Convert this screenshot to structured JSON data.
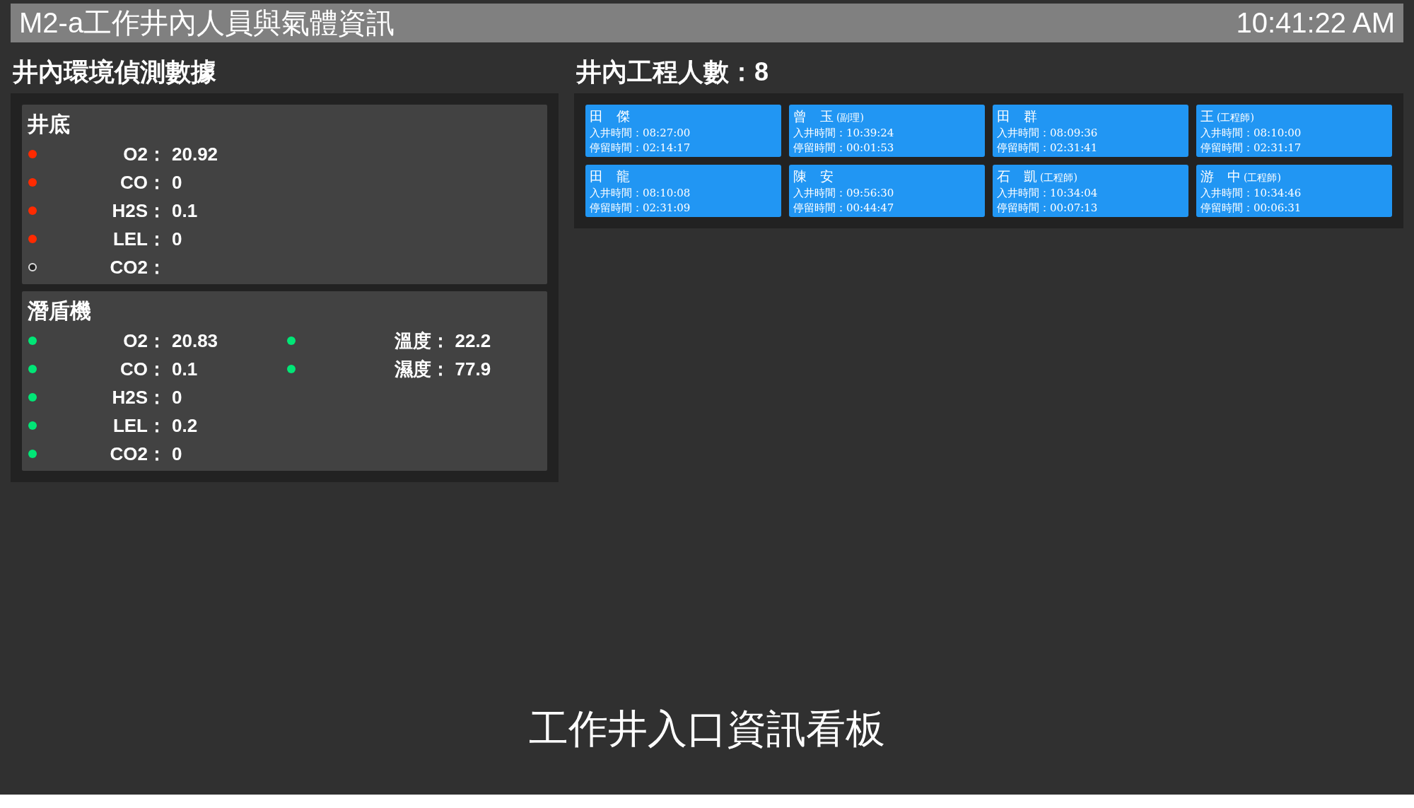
{
  "header": {
    "title": "M2-a工作井內人員與氣體資訊",
    "clock": "10:41:22 AM"
  },
  "environment": {
    "title": "井內環境偵測數據",
    "sections": [
      {
        "title": "井底",
        "gases": [
          {
            "label": "O2：",
            "value": "20.92",
            "color": "#ff2a00",
            "online": true
          },
          {
            "label": "CO：",
            "value": "0",
            "color": "#ff2a00",
            "online": true
          },
          {
            "label": "H2S：",
            "value": "0.1",
            "color": "#ff2a00",
            "online": true
          },
          {
            "label": "LEL：",
            "value": "0",
            "color": "#ff2a00",
            "online": true
          },
          {
            "label": "CO2：",
            "color": "#222222",
            "online": false
          }
        ]
      },
      {
        "title": "潛盾機",
        "gases": [
          {
            "label": "O2：",
            "value": "20.83",
            "color": "#00e676",
            "online": true
          },
          {
            "label": "CO：",
            "value": "0.1",
            "color": "#00e676",
            "online": true
          },
          {
            "label": "H2S：",
            "value": "0",
            "color": "#00e676",
            "online": true
          },
          {
            "label": "LEL：",
            "value": "0.2",
            "color": "#00e676",
            "online": true
          },
          {
            "label": "CO2：",
            "value": "0",
            "color": "#00e676",
            "online": true
          }
        ],
        "extras": [
          {
            "label": "溫度：",
            "value": "22.2",
            "color": "#00e676",
            "online": true
          },
          {
            "label": "濕度：",
            "value": "77.9",
            "color": "#00e676",
            "online": true
          }
        ]
      }
    ]
  },
  "personnel": {
    "title": "井內工程人數：8",
    "workers": [
      {
        "name": "田　傑",
        "entry": "入井時間：08:27:00",
        "stay": "停留時間：02:14:17"
      },
      {
        "name": "曾　玉",
        "title": "(副理)",
        "entry": "入井時間：10:39:24",
        "stay": "停留時間：00:01:53"
      },
      {
        "name": "田　群",
        "entry": "入井時間：08:09:36",
        "stay": "停留時間：02:31:41"
      },
      {
        "name": "王",
        "title": "(工程師)",
        "entry": "入井時間：08:10:00",
        "stay": "停留時間：02:31:17"
      },
      {
        "name": "田　龍",
        "entry": "入井時間：08:10:08",
        "stay": "停留時間：02:31:09"
      },
      {
        "name": "陳　安",
        "entry": "入井時間：09:56:30",
        "stay": "停留時間：00:44:47"
      },
      {
        "name": "石　凱",
        "title": "(工程師)",
        "entry": "入井時間：10:34:04",
        "stay": "停留時間：00:07:13"
      },
      {
        "name": "游　中",
        "title": "(工程師)",
        "entry": "入井時間：10:34:46",
        "stay": "停留時間：00:06:31"
      }
    ]
  },
  "footer": {
    "caption": "工作井入口資訊看板"
  }
}
